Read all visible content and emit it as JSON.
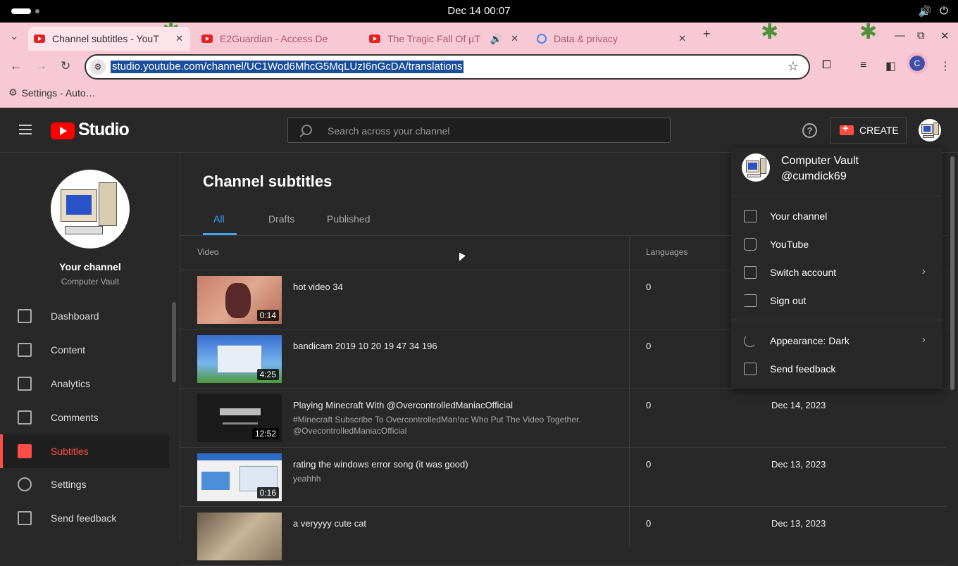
{
  "os": {
    "clock": "Dec 14  00:07",
    "icons": [
      "volume-icon",
      "power-icon"
    ]
  },
  "browser": {
    "tabs": [
      {
        "title": "Channel subtitles - YouT",
        "active": true
      },
      {
        "title": "E2Guardian - Access De",
        "active": false
      },
      {
        "title": "The Tragic Fall Of µT",
        "active": false,
        "audio": true
      },
      {
        "title": "Data & privacy",
        "active": false
      }
    ],
    "url": "studio.youtube.com/channel/UC1Wod6MhcG5MqLUzI6nGcDA/translations",
    "bookmark": "Settings - Auto…",
    "profile_initial": "C"
  },
  "studio": {
    "logo_text": "Studio",
    "search_placeholder": "Search across your channel",
    "create_label": "CREATE"
  },
  "sidebar": {
    "your_channel": "Your channel",
    "channel_name": "Computer Vault",
    "items": [
      {
        "label": "Dashboard",
        "icon": "dashboard-icon"
      },
      {
        "label": "Content",
        "icon": "content-icon"
      },
      {
        "label": "Analytics",
        "icon": "analytics-icon"
      },
      {
        "label": "Comments",
        "icon": "comments-icon"
      },
      {
        "label": "Subtitles",
        "icon": "subtitles-icon",
        "active": true
      },
      {
        "label": "Settings",
        "icon": "gear-icon"
      },
      {
        "label": "Send feedback",
        "icon": "feedback-icon"
      }
    ]
  },
  "main": {
    "title": "Channel subtitles",
    "tabs": [
      "All",
      "Drafts",
      "Published"
    ],
    "columns": {
      "video": "Video",
      "languages": "Languages"
    },
    "rows": [
      {
        "title": "hot video 34",
        "desc": "",
        "duration": "0:14",
        "languages": "0",
        "date": ""
      },
      {
        "title": "bandicam 2019 10 20 19 47 34 196",
        "desc": "",
        "duration": "4:25",
        "languages": "0",
        "date": ""
      },
      {
        "title": "Playing Minecraft With @OvercontrolledManiacOfficial",
        "desc": "#Minecraft Subscribe To OvercontrolledMan!ac Who Put The Video Together. @OvecontrolledManiacOfficial",
        "duration": "12:52",
        "languages": "0",
        "date": "Dec 14, 2023"
      },
      {
        "title": "rating the windows error song (it was good)",
        "desc": "yeahhh",
        "duration": "0:16",
        "languages": "0",
        "date": "Dec 13, 2023"
      },
      {
        "title": "a veryyyy cute cat",
        "desc": "",
        "duration": "",
        "languages": "0",
        "date": "Dec 13, 2023"
      }
    ]
  },
  "account_menu": {
    "name": "Computer Vault",
    "handle": "@cumdick69",
    "items": [
      {
        "label": "Your channel",
        "icon": "person-icon"
      },
      {
        "label": "YouTube",
        "icon": "youtube-icon"
      },
      {
        "label": "Switch account",
        "icon": "switch-account-icon",
        "chevron": true
      },
      {
        "label": "Sign out",
        "icon": "sign-out-icon"
      },
      {
        "label": "Appearance: Dark",
        "icon": "moon-icon",
        "chevron": true
      },
      {
        "label": "Send feedback",
        "icon": "feedback-icon"
      }
    ]
  },
  "colors": {
    "accent": "#3ea6ff",
    "brand_red": "#ff0000",
    "active_nav": "#ff4e45",
    "chrome_pink": "#f7c9d4"
  }
}
